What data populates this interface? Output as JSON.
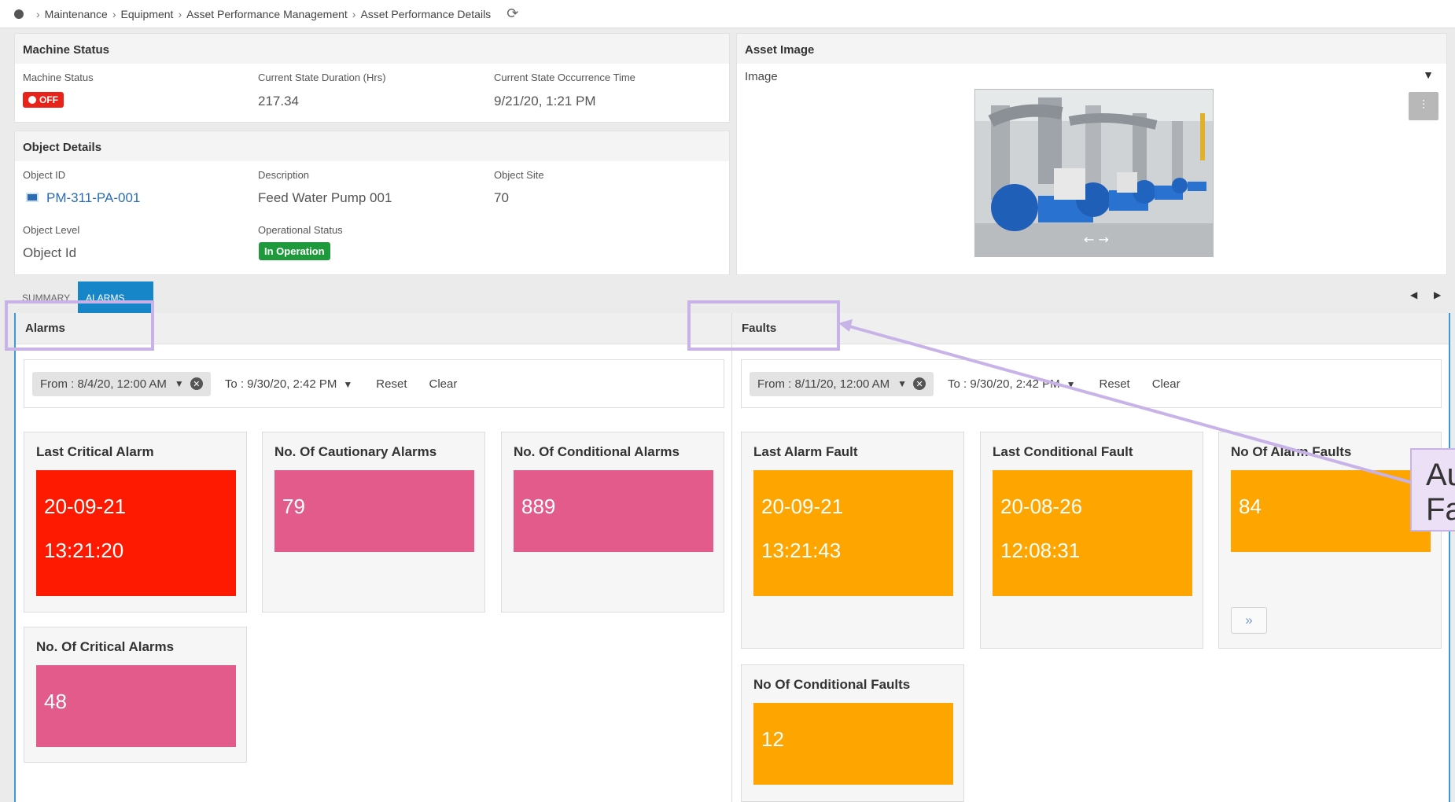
{
  "breadcrumb": {
    "items": [
      "Maintenance",
      "Equipment",
      "Asset Performance Management",
      "Asset Performance Details"
    ]
  },
  "machine_status": {
    "title": "Machine Status",
    "status_label": "Machine Status",
    "status_value": "OFF",
    "duration_label": "Current State Duration (Hrs)",
    "duration_value": "217.34",
    "occurrence_label": "Current State Occurrence Time",
    "occurrence_value": "9/21/20, 1:21 PM"
  },
  "object_details": {
    "title": "Object Details",
    "id_label": "Object ID",
    "id_value": "PM-311-PA-001",
    "desc_label": "Description",
    "desc_value": "Feed Water Pump 001",
    "site_label": "Object Site",
    "site_value": "70",
    "level_label": "Object Level",
    "level_value": "Object Id",
    "op_label": "Operational Status",
    "op_value": "In Operation"
  },
  "asset_image": {
    "title": "Asset Image",
    "label": "Image"
  },
  "tabs": [
    "SUMMARY",
    "ALARMS"
  ],
  "alarms": {
    "title": "Alarms",
    "from": "From : 8/4/20, 12:00 AM",
    "to": "To : 9/30/20, 2:42 PM",
    "reset": "Reset",
    "clear": "Clear",
    "cards": {
      "last_critical": {
        "title": "Last Critical Alarm",
        "date": "20-09-21",
        "time": "13:21:20"
      },
      "cautionary": {
        "title": "No. Of Cautionary Alarms",
        "value": "79"
      },
      "conditional": {
        "title": "No. Of Conditional Alarms",
        "value": "889"
      },
      "critical": {
        "title": "No. Of Critical Alarms",
        "value": "48"
      }
    }
  },
  "faults": {
    "title": "Faults",
    "from": "From : 8/11/20, 12:00 AM",
    "to": "To : 9/30/20, 2:42 PM",
    "reset": "Reset",
    "clear": "Clear",
    "cards": {
      "last_alarm": {
        "title": "Last Alarm Fault",
        "date": "20-09-21",
        "time": "13:21:43"
      },
      "last_conditional": {
        "title": "Last Conditional Fault",
        "date": "20-08-26",
        "time": "12:08:31"
      },
      "alarm_faults": {
        "title": "No Of Alarm Faults",
        "value": "84"
      },
      "conditional_faults": {
        "title": "No Of Conditional Faults",
        "value": "12"
      }
    }
  },
  "callout": {
    "line1": "Au",
    "line2": "Fa"
  },
  "colors": {
    "red": "#fe1a00",
    "pink": "#e25b8b",
    "orange": "#fea500",
    "accent": "#1786c9",
    "highlight": "#c8b3e8"
  }
}
